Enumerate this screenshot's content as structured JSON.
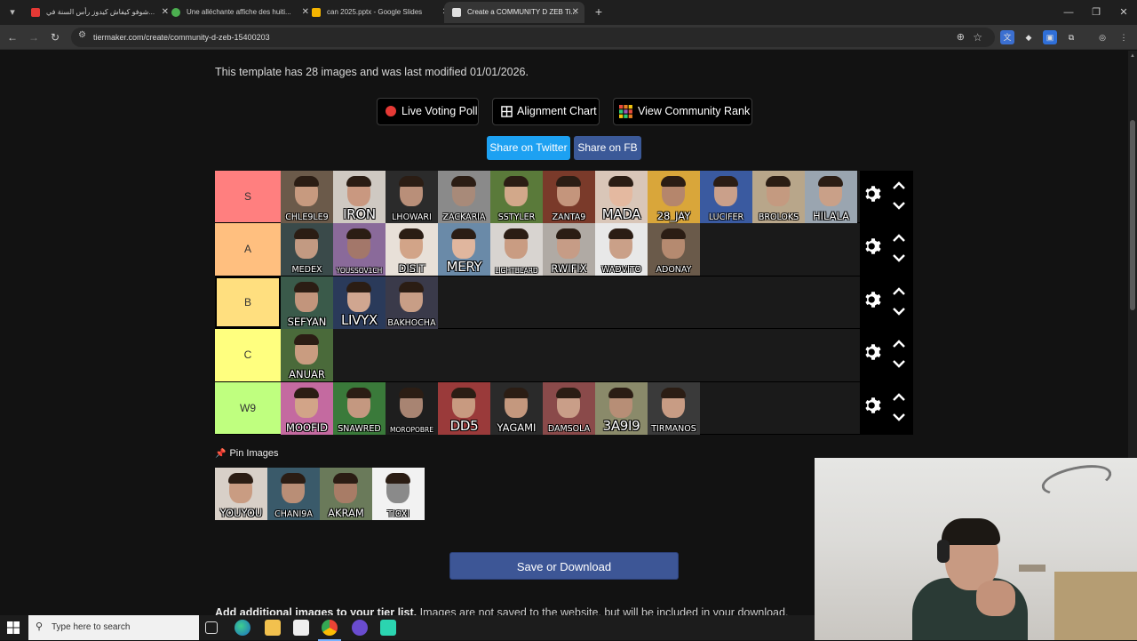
{
  "browser": {
    "tabs": [
      {
        "title": "شوفو كيفاش كيدوز رأس السنة في...",
        "fav_color": "#e53935",
        "active": false
      },
      {
        "title": "Une alléchante affiche des huiti...",
        "fav_color": "#4caf50",
        "active": false
      },
      {
        "title": "can 2025.pptx - Google Slides",
        "fav_color": "#f4b400",
        "active": false
      },
      {
        "title": "Create a COMMUNITY D ZEB Ti...",
        "fav_color": "#e0e0e0",
        "active": true
      }
    ],
    "url": "tiermaker.com/create/community-d-zeb-15400203"
  },
  "page": {
    "template_info": "This template has 28 images and was last modified 01/01/2026.",
    "buttons": {
      "live_voting": "Live Voting Poll",
      "alignment": "Alignment Chart",
      "community_rank": "View Community Rank",
      "share_twitter": "Share on Twitter",
      "share_fb": "Share on FB",
      "save": "Save or Download"
    },
    "pin_title": "Pin Images",
    "add_more_bold": "Add additional images to your tier list.",
    "add_more_rest": " Images are not saved to the website, but will be included in your download."
  },
  "tiers": [
    {
      "label": "S",
      "color": "#ff7f7f",
      "items": [
        {
          "name": "CHLE9LE9",
          "size": "small",
          "bg": "#6b5a4a",
          "skin": "#c79a7f"
        },
        {
          "name": "IRON",
          "size": "big",
          "bg": "#cfc9c2",
          "skin": "#c99880"
        },
        {
          "name": "LHOWARI",
          "size": "small",
          "bg": "#2b2b2b",
          "skin": "#b98f79"
        },
        {
          "name": "ZACKARIA",
          "size": "small",
          "bg": "#8a8a8a",
          "skin": "#a88a79"
        },
        {
          "name": "SSTYLER",
          "size": "small",
          "bg": "#5a7a3a",
          "skin": "#d2a88a"
        },
        {
          "name": "ZANTA9",
          "size": "small",
          "bg": "#7a3a2a",
          "skin": "#c4957c"
        },
        {
          "name": "MADA",
          "size": "big",
          "bg": "#d9c6b8",
          "skin": "#e4b9a0"
        },
        {
          "name": "28_JAY",
          "size": "med",
          "bg": "#d9a63a",
          "skin": "#b5866c"
        },
        {
          "name": "LUCIFER",
          "size": "small",
          "bg": "#3a5aa0",
          "skin": "#caa08a"
        },
        {
          "name": "BROLOKS",
          "size": "small",
          "bg": "#b8a68a",
          "skin": "#c49a80"
        },
        {
          "name": "HILALA",
          "size": "med",
          "bg": "#9aa5b0",
          "skin": "#c9a088"
        }
      ]
    },
    {
      "label": "A",
      "color": "#ffbf7f",
      "items": [
        {
          "name": "MEDEX",
          "size": "small",
          "bg": "#3a4a4a",
          "skin": "#c29a82"
        },
        {
          "name": "YOUSSOV1CH",
          "size": "tiny",
          "bg": "#8a6a9a",
          "skin": "#a3776a"
        },
        {
          "name": "DISIT",
          "size": "med",
          "bg": "#e8e0d8",
          "skin": "#d2a488"
        },
        {
          "name": "MERY",
          "size": "big",
          "bg": "#6a8aa8",
          "skin": "#e0b69e"
        },
        {
          "name": "LIGHTBEARD",
          "size": "tiny",
          "bg": "#d8d4d0",
          "skin": "#c99c82"
        },
        {
          "name": "RWIFIX",
          "size": "med",
          "bg": "#b0aaa4",
          "skin": "#c69c86"
        },
        {
          "name": "WADVITO",
          "size": "small",
          "bg": "#e8e8e8",
          "skin": "#caa088"
        },
        {
          "name": "ADONAY",
          "size": "small",
          "bg": "#6a5a4a",
          "skin": "#b58a70"
        }
      ]
    },
    {
      "label": "B",
      "color": "#ffdf7f",
      "selected": true,
      "items": [
        {
          "name": "SEFYAN",
          "size": "med",
          "bg": "#3a5a4a",
          "skin": "#c2957c"
        },
        {
          "name": "LIVYX",
          "size": "big",
          "bg": "#2a3a5a",
          "skin": "#d0a690"
        },
        {
          "name": "BAKHOCHA",
          "size": "small",
          "bg": "#3a3a4a",
          "skin": "#c89e86"
        }
      ]
    },
    {
      "label": "C",
      "color": "#ffff7f",
      "items": [
        {
          "name": "ANUAR",
          "size": "med",
          "bg": "#4a6a3a",
          "skin": "#c99c80"
        }
      ]
    },
    {
      "label": "W9",
      "color": "#bfff7f",
      "items": [
        {
          "name": "MOOFID",
          "size": "med",
          "bg": "#c46aa0",
          "skin": "#d2a488"
        },
        {
          "name": "SNAWRED",
          "size": "small",
          "bg": "#3a7a3a",
          "skin": "#c49880"
        },
        {
          "name": "MOROPOBRE",
          "size": "tiny",
          "bg": "#1e1e1e",
          "skin": "#a88472"
        },
        {
          "name": "DD5",
          "size": "big",
          "bg": "#9a3a3a",
          "skin": "#c89a80"
        },
        {
          "name": "YAGAMI",
          "size": "med",
          "bg": "#2a2a2a",
          "skin": "#c4987e"
        },
        {
          "name": "DAMSOLA",
          "size": "small",
          "bg": "#8a4a4a",
          "skin": "#c99e88"
        },
        {
          "name": "3A9I9",
          "size": "big",
          "bg": "#8a8a6a",
          "skin": "#b78e76"
        },
        {
          "name": "TIRMANOS",
          "size": "small",
          "bg": "#3a3a3a",
          "skin": "#c89c84"
        }
      ]
    }
  ],
  "pinned": [
    {
      "name": "YOUYOU",
      "size": "med",
      "bg": "#d8d0c8",
      "skin": "#c99c82"
    },
    {
      "name": "CHANI9A",
      "size": "small",
      "bg": "#3a5a6a",
      "skin": "#b98e76"
    },
    {
      "name": "AKRAM",
      "size": "med",
      "bg": "#6a7a5a",
      "skin": "#a87c66"
    },
    {
      "name": "TIOXI",
      "size": "small",
      "bg": "#f2f2f2",
      "skin": "#8a8a8a"
    }
  ],
  "taskbar": {
    "search_placeholder": "Type here to search"
  }
}
